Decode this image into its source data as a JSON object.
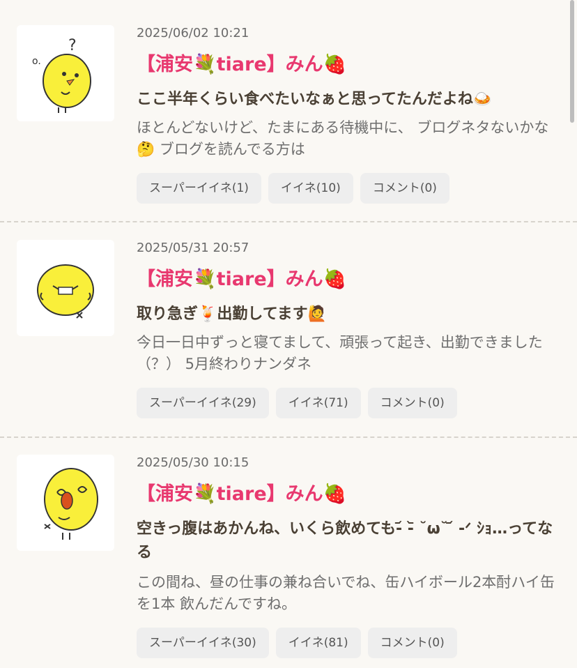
{
  "posts": [
    {
      "date": "2025/06/02 10:21",
      "author": "【浦安💐tiare】みん🍓",
      "title": "ここ半年くらい食べたいなぁと思ってたんだよね🍛",
      "excerpt": "ほとんどないけど、たまにある待機中に、 ブログネタないかな🤔 ブログを読んでる方は",
      "super_like": "スーパーイイネ(1)",
      "like": "イイネ(10)",
      "comment": "コメント(0)"
    },
    {
      "date": "2025/05/31 20:57",
      "author": "【浦安💐tiare】みん🍓",
      "title": "取り急ぎ🍹出勤してます🙋",
      "excerpt": "今日一日中ずっと寝てまして、頑張って起き、出勤できました（？） 5月終わりナンダネ",
      "super_like": "スーパーイイネ(29)",
      "like": "イイネ(71)",
      "comment": "コメント(0)"
    },
    {
      "date": "2025/05/30 10:15",
      "author": "【浦安💐tiare】みん🍓",
      "title": "空きっ腹はあかんね、いくら飲めても-᷄ -᷅ ˘ω˘ ᷄ -ᐟ ｼｮ…ってなる",
      "excerpt": "この間ね、昼の仕事の兼ね合いでね、缶ハイボール2本酎ハイ缶を1本 飲んだんですね。",
      "super_like": "スーパーイイネ(30)",
      "like": "イイネ(81)",
      "comment": "コメント(0)"
    }
  ],
  "colors": {
    "background": "#faf8f4",
    "author": "#e8386f",
    "title": "#4a4034",
    "button_bg": "#eeeeee"
  }
}
